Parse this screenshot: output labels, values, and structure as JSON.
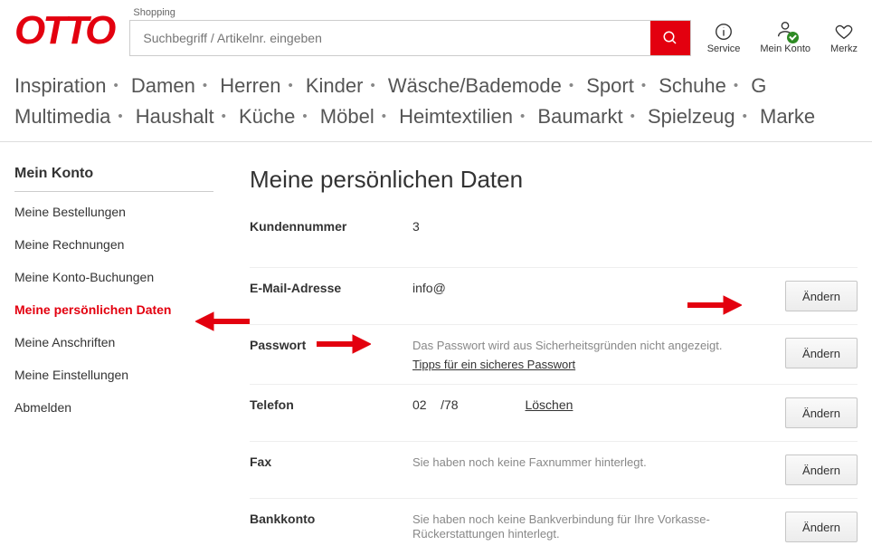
{
  "header": {
    "logo_text": "OTTO",
    "shopping_label": "Shopping",
    "search_placeholder": "Suchbegriff / Artikelnr. eingeben",
    "icons": {
      "service": "Service",
      "account": "Mein Konto",
      "wishlist": "Merkz"
    }
  },
  "nav": {
    "row1": [
      "Inspiration",
      "Damen",
      "Herren",
      "Kinder",
      "Wäsche/Bademode",
      "Sport",
      "Schuhe",
      "G"
    ],
    "row2": [
      "Multimedia",
      "Haushalt",
      "Küche",
      "Möbel",
      "Heimtextilien",
      "Baumarkt",
      "Spielzeug",
      "Marke"
    ]
  },
  "sidebar": {
    "title": "Mein Konto",
    "items": [
      "Meine Bestellungen",
      "Meine Rechnungen",
      "Meine Konto-Buchungen",
      "Meine persönlichen Daten",
      "Meine Anschriften",
      "Meine Einstellungen",
      "Abmelden"
    ]
  },
  "content": {
    "title": "Meine persönlichen Daten",
    "rows": {
      "customer_no": {
        "label": "Kundennummer",
        "value": "3"
      },
      "email": {
        "label": "E-Mail-Adresse",
        "value": "info@",
        "button": "Ändern"
      },
      "password": {
        "label": "Passwort",
        "note": "Das Passwort wird aus Sicherheitsgründen nicht angezeigt.",
        "tips": "Tipps für ein sicheres Passwort",
        "button": "Ändern"
      },
      "phone": {
        "label": "Telefon",
        "value": "02    /78",
        "delete": "Löschen",
        "button": "Ändern"
      },
      "fax": {
        "label": "Fax",
        "note": "Sie haben noch keine Faxnummer hinterlegt.",
        "button": "Ändern"
      },
      "bank": {
        "label": "Bankkonto",
        "note": "Sie haben noch keine Bankverbindung für Ihre Vorkasse-Rückerstattungen hinterlegt.",
        "button": "Ändern"
      }
    }
  }
}
